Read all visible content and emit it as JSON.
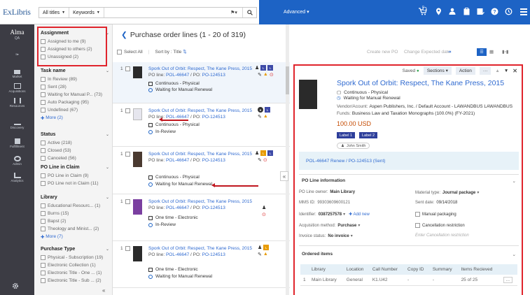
{
  "header": {
    "logo": "ExLibris",
    "search_scope": "All titles",
    "search_field": "Keywords",
    "advanced_label": "Advanced",
    "notif_count": "0"
  },
  "nav": {
    "app_name": "Alma",
    "env": "QA",
    "items": [
      "Market",
      "Acquisitions",
      "Resources",
      "Discovery",
      "Fulfillment",
      "Admin",
      "Analytics"
    ]
  },
  "facets": [
    {
      "title": "Assignment",
      "options": [
        "Assigned to me (9)",
        "Assigned to others (2)",
        "Unassigned (2)"
      ]
    },
    {
      "title": "Task name",
      "options": [
        "In Review (89)",
        "Sent (28)",
        "Waiting for Manual P... (73)",
        "Auto Packaging (95)",
        "Undefined (67)"
      ],
      "more": "More (2)"
    },
    {
      "title": "Status",
      "options": [
        "Active (218)",
        "Closed (53)",
        "Canceled (56)"
      ]
    },
    {
      "title": "PO Line in Claim",
      "options": [
        "PO Line in Claim (9)",
        "PO Line not in Claim (11)"
      ]
    },
    {
      "title": "Library",
      "options": [
        "Educational Resourc... (1)",
        "Burns (15)",
        "Bapst (2)",
        "Theology and Minist... (2)"
      ],
      "more": "More (7)"
    },
    {
      "title": "Purchase Type",
      "options": [
        "Physical - Subscription (19)",
        "Electronic Collection (1)",
        "Electronic Title - One ... (1)",
        "Electronic Title - Sub ... (2)"
      ]
    }
  ],
  "main": {
    "page_title": "Purchase order lines (1 - 20 of 319)",
    "select_all": "Select All",
    "sort_by": "Sort by : Title",
    "create_po": "Create new PO",
    "change_date": "Change Expected date"
  },
  "rows": [
    {
      "num": "1",
      "title": "Spork Out of Orbit: Respect, The Kane Press, 2015",
      "po_line_prefix": "PO line:",
      "po_line": "POL-46647",
      "po_sep": "/ PO:",
      "po": "PO-124513",
      "meta1": "Continuous - Physical",
      "meta2": "Waiting for Manual Renewal"
    },
    {
      "num": "1",
      "title": "Spork Out of Orbit: Respect, The Kane Press, 2015",
      "po_line_prefix": "PO line:",
      "po_line": "POL-46647",
      "po_sep": "/ PO:",
      "po": "PO-124513",
      "meta1": "Continuous - Physical",
      "meta2": "In-Review"
    },
    {
      "num": "1",
      "title": "Spork Out of Orbit: Respect, The Kane Press, 2015",
      "po_line_prefix": "PO line:",
      "po_line": "POL-46647",
      "po_sep": "/ PO:",
      "po": "PO-124513",
      "meta1": "Continuous - Physical",
      "meta2": "Waiting for Manual Renewal"
    },
    {
      "num": "1",
      "title": "Spork Out of Orbit: Respect, The Kane Press, 2015",
      "po_line_prefix": "PO line:",
      "po_line": "POL-46647",
      "po_sep": "/ PO:",
      "po": "PO-124513",
      "meta1": "One time - Electronic",
      "meta2": "In-Review"
    },
    {
      "num": "1",
      "title": "Spork Out of Orbit: Respect, The Kane Press, 2015",
      "po_line_prefix": "PO line:",
      "po_line": "POL-46647",
      "po_sep": "/ PO:",
      "po": "PO-124513",
      "meta1": "One time - Electronic",
      "meta2": "Waiting for Manual Renewal"
    }
  ],
  "detail": {
    "saved": "Saved",
    "sections_btn": "Sections",
    "action_btn": "Action",
    "title": "Spork Out of Orbit: Respect, The Kane Press, 2015",
    "type": "Continuous - Physical",
    "status": "Waiting for Manual Renewal",
    "vendor_key": "Vendor/Acount:",
    "vendor_val": "Aspen Publishers, Inc. / Default Account - LAWANDBUS LAWANDBUS",
    "funds_key": "Funds:",
    "funds_val": "Business Law and Taxation Monographs (100.0%) (FY-2021)",
    "price": "100.00 USD",
    "label1": "Label 1",
    "label2": "Label 2",
    "user": "John Smith",
    "renew": "POL-46647 Renew / PO-124513 (Sent)",
    "poline_info": "PO Line information",
    "owner_k": "PO Line owner:",
    "owner_v": "Main Library",
    "mms_k": "MMS ID:",
    "mms_v": "99303609600121",
    "ident_k": "Identifier:",
    "ident_v": "0387257578",
    "add_new": "Add new",
    "acq_k": "Acquisition method:",
    "acq_v": "Purchase",
    "inv_k": "Invoice status:",
    "inv_v": "No invoice",
    "mat_k": "Material type:",
    "mat_v": "Journal package",
    "sent_k": "Sent date:",
    "sent_v": "09/14/2018",
    "manual": "Manual packaging",
    "cancel": "Cancellation restriction",
    "cancel_ph": "Enter Cancellation restriction",
    "ordered": "Ordered items",
    "table_headers": [
      "Library",
      "Location",
      "Call Number",
      "Copy ID",
      "Summary",
      "Items Recieved"
    ],
    "table_row": [
      "1",
      "Main Library",
      "General",
      "K1.U42",
      "-",
      "-",
      "25 of 25",
      "..."
    ]
  }
}
